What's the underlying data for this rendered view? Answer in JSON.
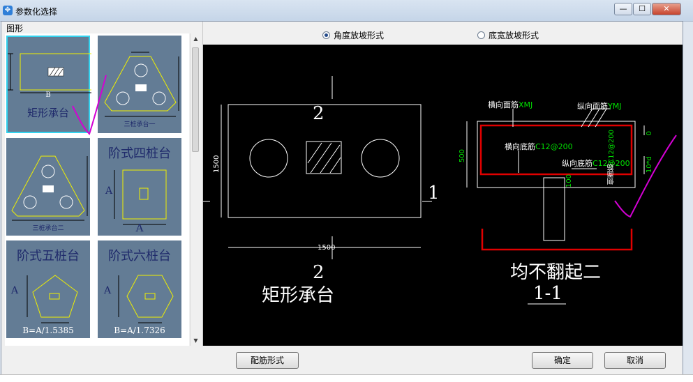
{
  "window": {
    "title": "参数化选择",
    "minimize_glyph": "—",
    "maximize_glyph": "☐",
    "close_glyph": "✕"
  },
  "left": {
    "label": "图形",
    "thumbnails": [
      {
        "caption": "矩形承台",
        "dim": "B"
      },
      {
        "caption": "三桩承台一"
      },
      {
        "caption": "三桩承台二"
      },
      {
        "caption": "阶式四桩台",
        "dim": "A"
      },
      {
        "caption": "阶式五桩台",
        "formula": "B=A/1.5385",
        "dim": "A"
      },
      {
        "caption": "阶式六桩台",
        "formula": "B=A/1.7326",
        "dim": "A"
      }
    ]
  },
  "radios": [
    {
      "label": "角度放坡形式",
      "checked": true
    },
    {
      "label": "底宽放坡形式",
      "checked": false
    }
  ],
  "drawing": {
    "plan_title": "矩形承台",
    "section_top": "2",
    "section_bottom": "2",
    "section_right": "1",
    "dim_height": "1500",
    "dim_width": "1500",
    "section_title": "均不翻起二",
    "section_name": "1-1",
    "labels": {
      "top_transverse": "横向面筋",
      "top_transverse_val": "XMJ",
      "top_longitudinal": "纵向面筋",
      "top_longitudinal_val": "YMJ",
      "bottom_transverse": "横向底筋",
      "bottom_transverse_val": "C12@200",
      "bottom_longitudinal": "纵向底筋",
      "bottom_longitudinal_val": "C12@200",
      "side": "侧面筋",
      "side_val": "C12@200",
      "dim_500": "500",
      "dim_0": "0",
      "dim_10d": "10*d",
      "dim_100": "100"
    }
  },
  "buttons": {
    "rebar_form": "配筋形式",
    "ok": "确定",
    "cancel": "取消"
  }
}
